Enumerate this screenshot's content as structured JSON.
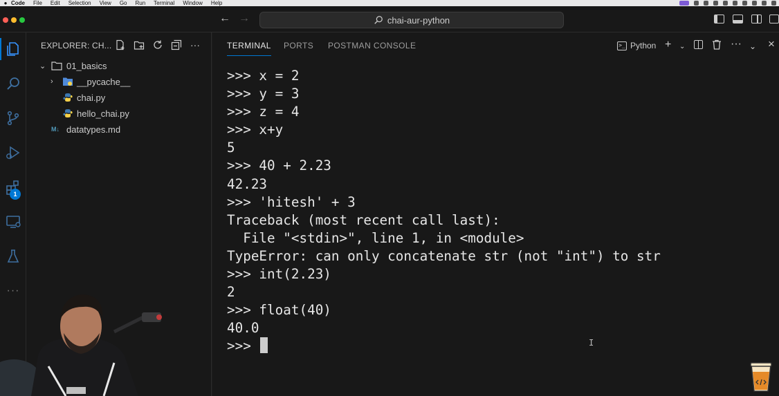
{
  "menubar": {
    "app": "Code",
    "items": [
      "File",
      "Edit",
      "Selection",
      "View",
      "Go",
      "Run",
      "Terminal",
      "Window",
      "Help"
    ]
  },
  "titlebar": {
    "search_text": "chai-aur-python"
  },
  "activity": {
    "extensions_badge": "1"
  },
  "sidebar": {
    "title": "EXPLORER: CH...",
    "tree": {
      "folder": "01_basics",
      "subfolder": "__pycache__",
      "file1": "chai.py",
      "file2": "hello_chai.py",
      "md_icon": "M↓",
      "file3": "datatypes.md"
    }
  },
  "panel": {
    "tabs": [
      "TERMINAL",
      "PORTS",
      "POSTMAN CONSOLE"
    ],
    "active_tab": "TERMINAL",
    "terminal_profile": "Python"
  },
  "terminal": {
    "lines": [
      ">>> x = 2",
      ">>> y = 3",
      ">>> z = 4",
      ">>> x+y",
      "5",
      ">>> 40 + 2.23",
      "42.23",
      ">>> 'hitesh' + 3",
      "Traceback (most recent call last):",
      "  File \"<stdin>\", line 1, in <module>",
      "TypeError: can only concatenate str (not \"int\") to str",
      ">>> int(2.23)",
      "2",
      ">>> float(40)",
      "40.0"
    ],
    "prompt": ">>> "
  },
  "colors": {
    "accent": "#0078d4",
    "python_blue": "#3b77b1",
    "python_yellow": "#f5d14a",
    "folder_blue": "#4f8ad9"
  }
}
